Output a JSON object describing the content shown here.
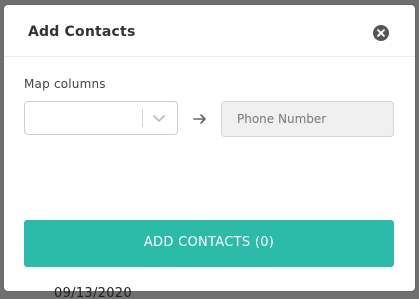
{
  "background": {
    "top_text": "",
    "date_text": "09/13/2020"
  },
  "modal": {
    "title": "Add Contacts",
    "close_icon": "close-icon",
    "map_columns_label": "Map columns",
    "select_value": "",
    "target_field_value": "Phone Number",
    "submit_label": "ADD CONTACTS (0)",
    "colors": {
      "accent": "#2bbba8",
      "overlay": "#6f6f6f",
      "field_bg": "#f0f0f0"
    }
  }
}
